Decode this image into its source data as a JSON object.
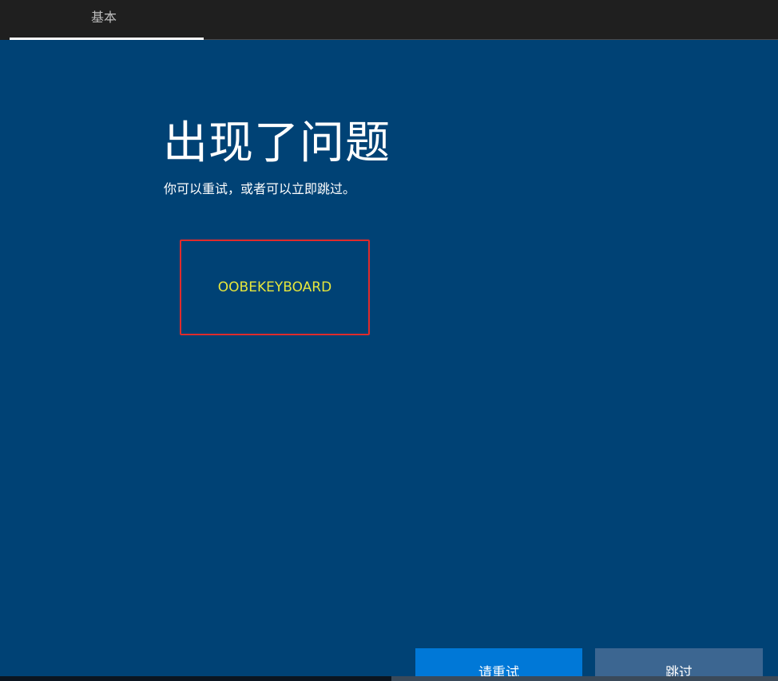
{
  "header": {
    "tabs": [
      {
        "label": "基本",
        "active": true
      }
    ]
  },
  "main": {
    "title": "出现了问题",
    "subtitle": "你可以重试，或者可以立即跳过。",
    "error_code": "OOBEKEYBOARD"
  },
  "actions": {
    "retry_label": "请重试",
    "skip_label": "跳过"
  },
  "colors": {
    "background": "#004275",
    "topbar": "#1f1f1f",
    "primary_button": "#0078d7",
    "secondary_button": "#3c6691",
    "error_border": "#e02b2b",
    "error_text": "#e6e63c"
  }
}
